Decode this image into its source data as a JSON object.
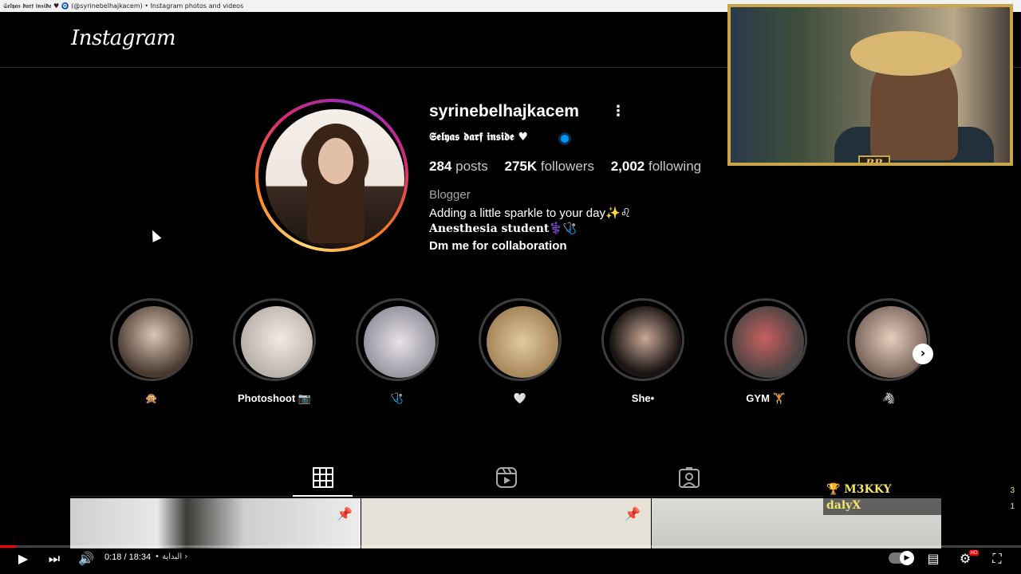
{
  "window": {
    "title": "𝕾𝖊𝖑𝖞𝖆𝖘 𝖉𝖆𝖗𝖋 𝖎𝖓𝖘𝖎𝖉𝖊 ♥︎ 🧿 (@syrinebelhajkacem) • Instagram photos and videos"
  },
  "header": {
    "logo": "Instagram"
  },
  "profile": {
    "username": "syrinebelhajkacem",
    "display_name": "𝕾𝖊𝖑𝖞𝖆𝖘 𝖉𝖆𝖗𝖋 𝖎𝖓𝖘𝖎𝖉𝖊 ♥︎",
    "stats": {
      "posts_count": "284",
      "posts_label": "posts",
      "followers_count": "275K",
      "followers_label": "followers",
      "following_count": "2,002",
      "following_label": "following"
    },
    "category": "Blogger",
    "bio": [
      "Adding a little sparkle to your day✨♌︎",
      "𝐀𝐧𝐞𝐬𝐭𝐡𝐞𝐬𝐢𝐚 𝐬𝐭𝐮𝐝𝐞𝐧𝐭⚕️🩺",
      "Dm me for collaboration"
    ]
  },
  "highlights": [
    {
      "label": "🙊",
      "color": "#6a5a4a"
    },
    {
      "label": "Photoshoot 📷",
      "color": "#cfc8c0"
    },
    {
      "label": "🩺",
      "color": "#b8b4b8"
    },
    {
      "label": "🤍",
      "color": "#c6a77a"
    },
    {
      "label": "She•",
      "color": "#3a2e2a"
    },
    {
      "label": "GYM 🏋️",
      "color": "#8a7a76"
    },
    {
      "label": "🦓",
      "color": "#b8a296"
    }
  ],
  "tabs": [
    {
      "name": "posts",
      "icon": "grid-icon",
      "active": true
    },
    {
      "name": "reels",
      "icon": "reels-icon",
      "active": false
    },
    {
      "name": "tagged",
      "icon": "tagged-icon",
      "active": false
    }
  ],
  "chat": [
    {
      "user": "🏆 M3KKY",
      "count": "3"
    },
    {
      "user": "dalyX",
      "count": "1"
    }
  ],
  "webcam": {
    "badge": "RR"
  },
  "player": {
    "time": "0:18 / 18:34",
    "chapter": "• البداية",
    "progress_fraction": 0.016
  },
  "colors": {
    "accent": "#0095f6",
    "background": "#000000",
    "progress": "#ff0000"
  }
}
